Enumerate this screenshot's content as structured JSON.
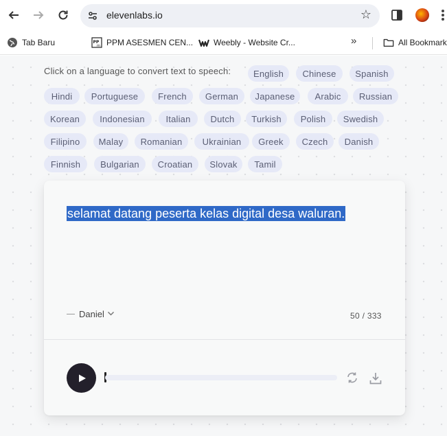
{
  "browser": {
    "url": "elevenlabs.io",
    "bookmarks": [
      {
        "label": "Tab Baru",
        "icon": "globe-icon"
      },
      {
        "label": "PPM ASESMEN CEN...",
        "icon": "ppm-favicon"
      },
      {
        "label": "Weebly - Website Cr...",
        "icon": "weebly-favicon"
      }
    ],
    "all_bookmarks_label": "All Bookmarks"
  },
  "languages": {
    "intro": "Click on a language to convert text to speech:",
    "items": [
      "English",
      "Chinese",
      "Spanish",
      "Hindi",
      "Portuguese",
      "French",
      "German",
      "Japanese",
      "Arabic",
      "Russian",
      "Korean",
      "Indonesian",
      "Italian",
      "Dutch",
      "Turkish",
      "Polish",
      "Swedish",
      "Filipino",
      "Malay",
      "Romanian",
      "Ukrainian",
      "Greek",
      "Czech",
      "Danish",
      "Finnish",
      "Bulgarian",
      "Croatian",
      "Slovak",
      "Tamil"
    ]
  },
  "editor": {
    "text": "selamat datang peserta kelas digital desa waluran.",
    "voice": "Daniel",
    "char_count": "50 / 333"
  },
  "colors": {
    "chip_bg": "#e6e9f7",
    "selection": "#2f69c7",
    "play_button": "#23202b"
  }
}
